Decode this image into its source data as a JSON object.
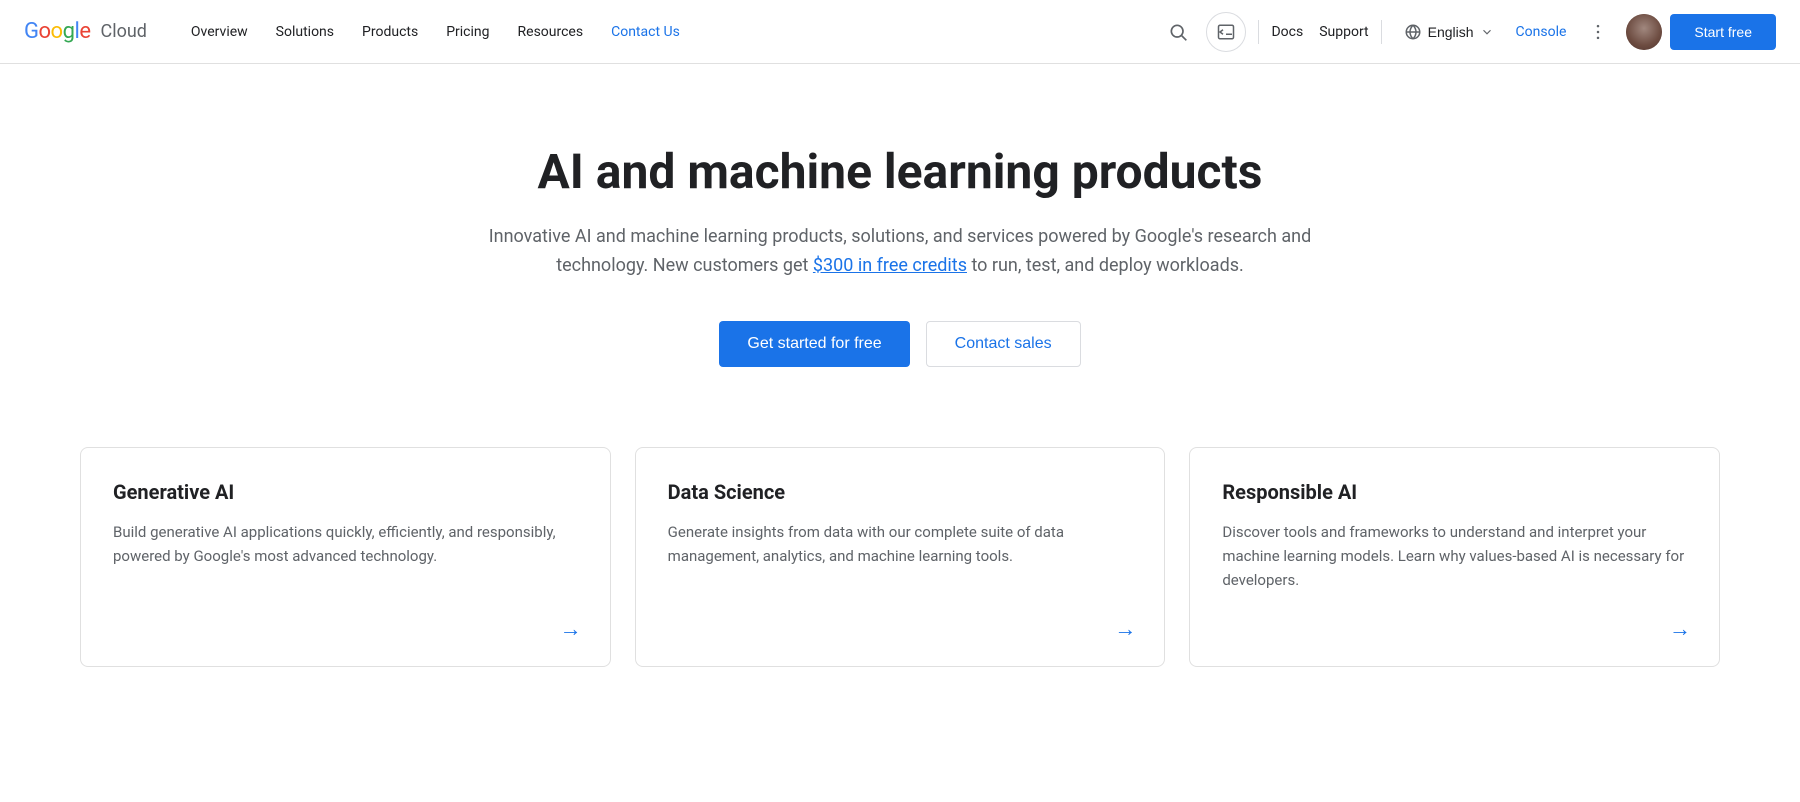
{
  "navbar": {
    "logo_google": "Google",
    "logo_cloud": "Cloud",
    "nav_items": [
      {
        "label": "Overview",
        "active": false
      },
      {
        "label": "Solutions",
        "active": false
      },
      {
        "label": "Products",
        "active": false
      },
      {
        "label": "Pricing",
        "active": false
      },
      {
        "label": "Resources",
        "active": false
      },
      {
        "label": "Contact Us",
        "active": true
      }
    ],
    "docs_label": "Docs",
    "support_label": "Support",
    "language_label": "English",
    "console_label": "Console",
    "start_free_label": "Start free"
  },
  "hero": {
    "title": "AI and machine learning products",
    "description_before": "Innovative AI and machine learning products, solutions, and services powered by Google's research and technology. New customers get ",
    "description_link": "$300 in free credits",
    "description_after": " to run, test, and deploy workloads.",
    "btn_primary": "Get started for free",
    "btn_secondary": "Contact sales"
  },
  "cards": [
    {
      "title": "Generative AI",
      "description": "Build generative AI applications quickly, efficiently, and responsibly, powered by Google's most advanced technology.",
      "arrow": "→"
    },
    {
      "title": "Data Science",
      "description": "Generate insights from data with our complete suite of data management, analytics, and machine learning tools.",
      "arrow": "→"
    },
    {
      "title": "Responsible AI",
      "description": "Discover tools and frameworks to understand and interpret your machine learning models. Learn why values-based AI is necessary for developers.",
      "arrow": "→"
    }
  ]
}
